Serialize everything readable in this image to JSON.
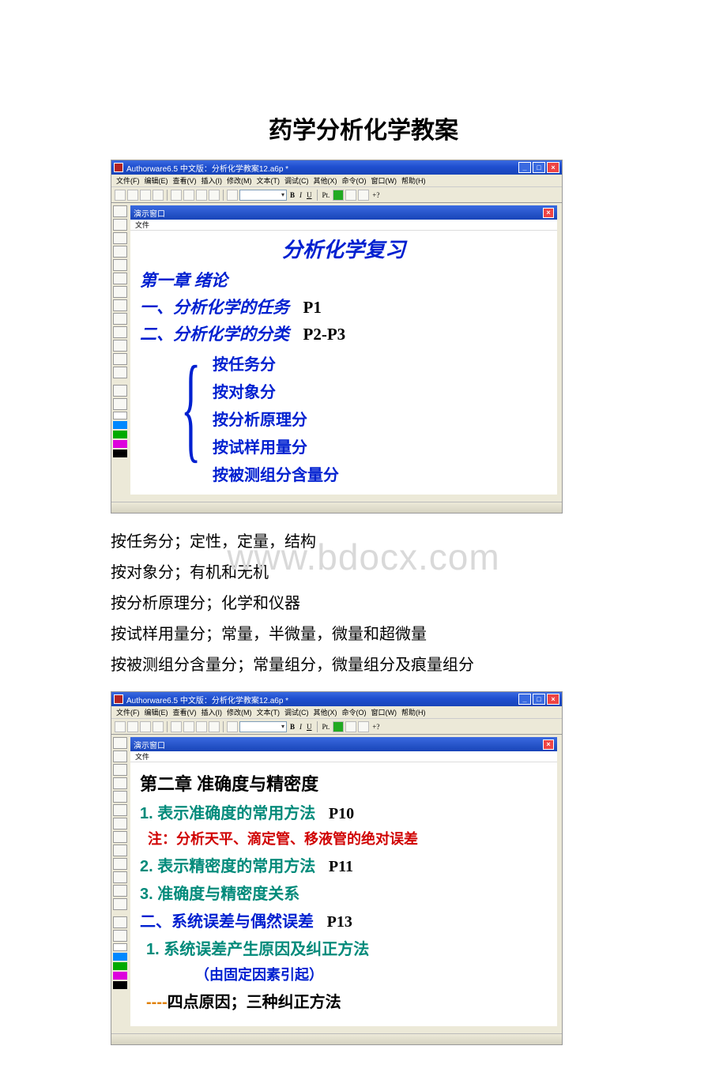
{
  "doc_title": "药学分析化学教案",
  "watermark": "www.bdocx.com",
  "app": {
    "title": "Authorware6.5 中文版：分析化学教案12.a6p *",
    "menus": [
      "文件(F)",
      "编辑(E)",
      "查看(V)",
      "插入(I)",
      "修改(M)",
      "文本(T)",
      "调试(C)",
      "其他(X)",
      "命令(O)",
      "窗口(W)",
      "帮助(H)"
    ],
    "tb_text": {
      "b": "B",
      "i": "I",
      "u": "U",
      "pt": "Pt.",
      "q": "+?"
    },
    "panel_title": "演示窗口",
    "panel_sub": "文件"
  },
  "slide1": {
    "title": "分析化学复习",
    "h1": "第一章  绪论",
    "r1_blue": "一、分析化学的任务",
    "r1_p": "P1",
    "r2_blue": "二、分析化学的分类",
    "r2_p": "P2-P3",
    "items": [
      "按任务分",
      "按对象分",
      "按分析原理分",
      "按试样用量分",
      "按被测组分含量分"
    ]
  },
  "notes": [
    "按任务分；定性，定量，结构",
    "按对象分；有机和无机",
    "按分析原理分；化学和仪器",
    "按试样用量分；常量，半微量，微量和超微量",
    "按被测组分含量分；常量组分，微量组分及痕量组分"
  ],
  "slide2": {
    "h1": "第二章  准确度与精密度",
    "r1_teal": "1. 表示准确度的常用方法",
    "r1_p": "P10",
    "note_red": "注：分析天平、滴定管、移液管的绝对误差",
    "r2_teal": "2. 表示精密度的常用方法",
    "r2_p": "P11",
    "r3_teal": "3. 准确度与精密度关系",
    "s2": "二、系统误差与偶然误差",
    "s2_p": "P13",
    "s2_1": "1. 系统误差产生原因及纠正方法",
    "s2_1_sub": "（由固定因素引起）",
    "s2_dash": "----",
    "s2_2": "四点原因；三种纠正方法"
  },
  "chart_data": {
    "type": "table",
    "title": "分析化学的分类",
    "rows": [
      {
        "criterion": "按任务分",
        "categories": [
          "定性",
          "定量",
          "结构"
        ]
      },
      {
        "criterion": "按对象分",
        "categories": [
          "有机",
          "无机"
        ]
      },
      {
        "criterion": "按分析原理分",
        "categories": [
          "化学",
          "仪器"
        ]
      },
      {
        "criterion": "按试样用量分",
        "categories": [
          "常量",
          "半微量",
          "微量",
          "超微量"
        ]
      },
      {
        "criterion": "按被测组分含量分",
        "categories": [
          "常量组分",
          "微量组分",
          "痕量组分"
        ]
      }
    ]
  }
}
